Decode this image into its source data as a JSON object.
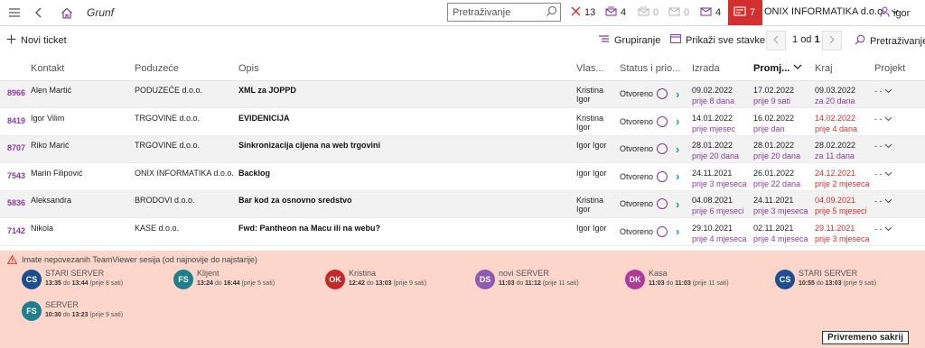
{
  "app": {
    "module_title": "Grunf",
    "company": "ONIX INFORMATIKA d.o.o.",
    "user": "igor"
  },
  "search": {
    "placeholder": "Pretraživanje"
  },
  "counters": [
    {
      "icon": "close-icon",
      "value": "13"
    },
    {
      "icon": "mail-open-icon",
      "value": "4"
    },
    {
      "icon": "mail-open-icon",
      "value": "0"
    },
    {
      "icon": "mail-icon",
      "value": "0"
    },
    {
      "icon": "mail-icon",
      "value": "4"
    },
    {
      "icon": "mail-alert-icon",
      "value": "7"
    }
  ],
  "toolbar": {
    "new_ticket": "Novi ticket",
    "group": "Grupiranje",
    "show_all": "Prikaži sve stavke",
    "page_current": "1",
    "page_sep": "od",
    "page_total": "1",
    "search": "Pretraživanje"
  },
  "columns": [
    "Kontakt",
    "Poduzeće",
    "Opis",
    "Vlas...",
    "Status i prio...",
    "Izrada",
    "Promj...",
    "Kraj",
    "Projekt"
  ],
  "rows": [
    {
      "id": "8966",
      "kontakt": "Alen Martić",
      "firma": "PODUZEĆE d.o.o.",
      "opis": "XML za JOPPD",
      "vlasnik": "Kristina Igor",
      "status": "Otvoreno",
      "izrada": "09.02.2022",
      "izrada_rel": "prije 8 dana",
      "promjena": "17.02.2022",
      "promjena_rel": "prije 9 sati",
      "kraj": "09.03.2022",
      "kraj_rel": "za 20 dana",
      "projekt": "- -"
    },
    {
      "id": "8419",
      "kontakt": "Igor Vilim",
      "firma": "TRGOVINE d.o.o.",
      "opis": "EVIDENICIJA",
      "vlasnik": "Kristina Igor",
      "status": "Otvoreno",
      "izrada": "14.01.2022",
      "izrada_rel": "prije mjesec",
      "promjena": "16.02.2022",
      "promjena_rel": "prije dan",
      "kraj": "14.02.2022",
      "kraj_rel": "prije 4 dana",
      "projekt": "- -"
    },
    {
      "id": "8707",
      "kontakt": "Riko Marić",
      "firma": "TRGOVINE d.o.o.",
      "opis": "Sinkronizacija cijena na web trgovini",
      "vlasnik": "Igor Igor",
      "status": "Otvoreno",
      "izrada": "28.01.2022",
      "izrada_rel": "prije 20 dana",
      "promjena": "28.01.2022",
      "promjena_rel": "prije 20 dana",
      "kraj": "28.02.2022",
      "kraj_rel": "za 11 dana",
      "projekt": "- -"
    },
    {
      "id": "7543",
      "kontakt": "Marin Filipović",
      "firma": "ONIX INFORMATIKA d.o.o.",
      "opis": "Backlog",
      "vlasnik": "Igor Igor",
      "status": "Otvoreno",
      "izrada": "24.11.2021",
      "izrada_rel": "prije 3 mjeseca",
      "promjena": "26.01.2022",
      "promjena_rel": "prije 22 dana",
      "kraj": "24.12.2021",
      "kraj_rel": "prije 2 mjeseca",
      "projekt": "- -"
    },
    {
      "id": "5836",
      "kontakt": "Aleksandra",
      "firma": "BRODOVI d.o.o.",
      "opis": "Bar kod za osnovno sredstvo",
      "vlasnik": "Kristina Igor",
      "status": "Otvoreno",
      "izrada": "04.08.2021",
      "izrada_rel": "prije 6 mjeseci",
      "promjena": "24.11.2021",
      "promjena_rel": "prije 3 mjeseca",
      "kraj": "04.09.2021",
      "kraj_rel": "prije 5 mjeseci",
      "projekt": "- -"
    },
    {
      "id": "7142",
      "kontakt": "Nikola",
      "firma": "KASE d.o.o.",
      "opis": "Fwd: Pantheon na Macu ili na webu?",
      "vlasnik": "Igor Igor",
      "status": "Otvoreno",
      "izrada": "29.10.2021",
      "izrada_rel": "prije 4 mjeseca",
      "promjena": "02.11.2021",
      "promjena_rel": "prije 4 mjeseca",
      "kraj": "29.11.2021",
      "kraj_rel": "prije 3 mjeseca",
      "projekt": "- -"
    }
  ],
  "teamviewer": {
    "title": "Imate nepovezanih TeamViewer sesija (od najnovije do najstarije)",
    "sessions": [
      {
        "initials": "CS",
        "color": "#1d4e8f",
        "name": "STARI SERVER",
        "from": "13:35",
        "to": "13:44",
        "ago": "(prije 8 sati)"
      },
      {
        "initials": "FS",
        "color": "#1f7f8c",
        "name": "Klijent",
        "from": "13:24",
        "to": "16:44",
        "ago": "(prije 5 sati)"
      },
      {
        "initials": "OK",
        "color": "#c62828",
        "name": "Kristina",
        "from": "12:42",
        "to": "13:03",
        "ago": "(prije 9 sati)"
      },
      {
        "initials": "DS",
        "color": "#8e5bb3",
        "name": "novi SERVER",
        "from": "11:03",
        "to": "11:12",
        "ago": "(prije 11 sati)"
      },
      {
        "initials": "DK",
        "color": "#b0399a",
        "name": "Kasa",
        "from": "11:03",
        "to": "11:03",
        "ago": "(prije 11 sati)"
      },
      {
        "initials": "CS",
        "color": "#1d4e8f",
        "name": "STARI SERVER",
        "from": "10:55",
        "to": "13:03",
        "ago": "(prije 9 sati)"
      },
      {
        "initials": "FS",
        "color": "#1f7f8c",
        "name": "SERVER",
        "from": "10:30",
        "to": "13:23",
        "ago": "(prije 9 sati)"
      }
    ],
    "joiner": "do",
    "hide_button": "Privremeno sakrij"
  }
}
